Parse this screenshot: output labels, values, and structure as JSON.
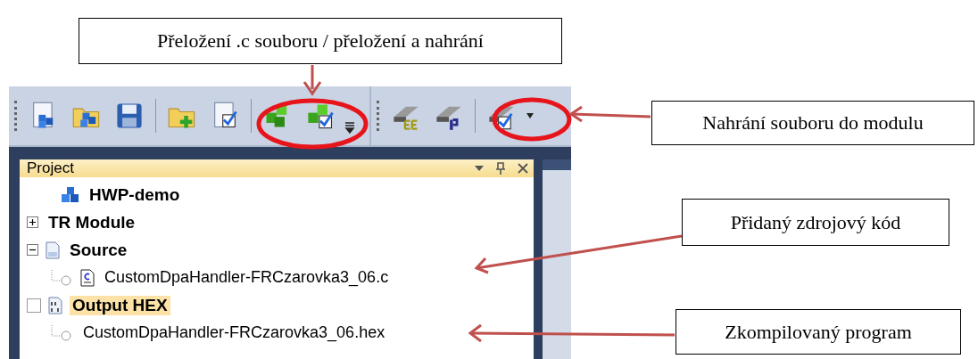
{
  "callouts": [
    {
      "text": "Přeložení .c souboru / přeložení a nahrání"
    },
    {
      "text": "Nahrání souboru do modulu"
    },
    {
      "text": "Přidaný zdrojový kód"
    },
    {
      "text": "Zkompilovaný program"
    }
  ],
  "project_panel": {
    "title": "Project",
    "items": [
      {
        "label": "HWP-demo",
        "kind": "project",
        "selected": false
      },
      {
        "label": "TR Module",
        "kind": "folder",
        "expanded": false,
        "selected": false
      },
      {
        "label": "Source",
        "kind": "source",
        "expanded": true,
        "selected": false,
        "children": [
          {
            "label": "CustomDpaHandler-FRCzarovka3_06.c",
            "kind": "cfile",
            "selected": false
          }
        ]
      },
      {
        "label": "Output HEX",
        "kind": "output",
        "checked": false,
        "selected": true,
        "children": [
          {
            "label": "CustomDpaHandler-FRCzarovka3_06.hex",
            "kind": "hexfile",
            "selected": false
          }
        ]
      }
    ]
  }
}
